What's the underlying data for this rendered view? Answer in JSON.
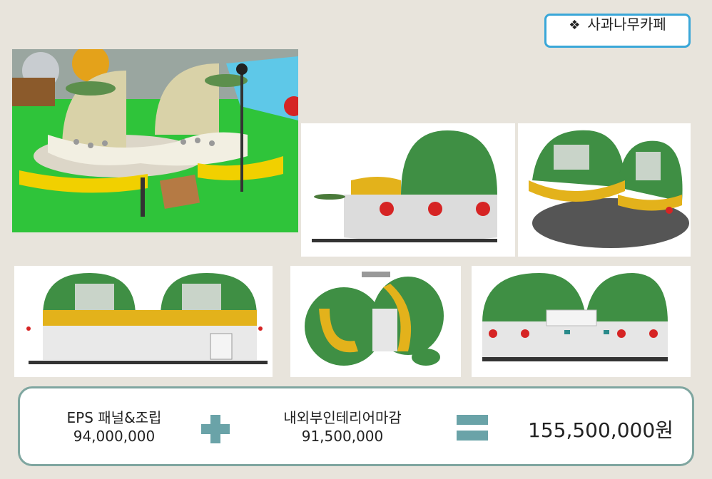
{
  "title": {
    "bullet": "❖",
    "text": "사과나무카페"
  },
  "panels": [
    "site-render-aerial",
    "side-elevation-view",
    "isometric-top-view",
    "front-elevation-view",
    "plan-top-view",
    "rear-elevation-view"
  ],
  "summary": {
    "item1_label": "EPS 패널&조립",
    "item1_value": "94,000,000",
    "item2_label": "내외부인테리어마감",
    "item2_value": "91,500,000",
    "total": "155,500,000원"
  },
  "colors": {
    "accent_blue": "#3aa7d8",
    "summary_border": "#7fa6a0",
    "operator": "#6aa3a8",
    "dome_green": "#3f8f44",
    "trim_yellow": "#e3b21b",
    "apple_red": "#d62424"
  }
}
